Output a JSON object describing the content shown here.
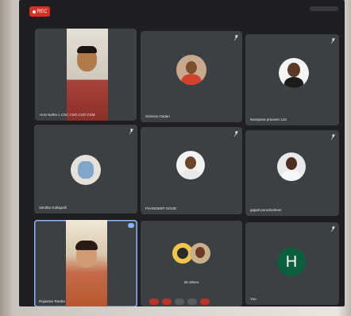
{
  "meeting": {
    "rec_label": "REC",
    "participants": [
      {
        "name": "HoS Nalha 1 CSC CSO CSO CSM",
        "type": "video"
      },
      {
        "name": "Srinivas Gadari",
        "type": "avatar"
      },
      {
        "name": "Narayana praveen 143",
        "type": "avatar"
      },
      {
        "name": "Vanitha Gollapalli",
        "type": "avatar"
      },
      {
        "name": "PSANDEEP GOUD",
        "type": "avatar"
      },
      {
        "name": "gajaal purushotham",
        "type": "avatar"
      },
      {
        "name": "Rajasree Tandra",
        "type": "video"
      },
      {
        "name": "28 others",
        "type": "group"
      },
      {
        "name": "You",
        "type": "letter",
        "letter": "H"
      }
    ]
  },
  "colors": {
    "tile": "#3c4043",
    "background": "#1f1f21",
    "rec": "#d93025",
    "you_avatar": "#0b5e3e",
    "speaking_border": "#8ab4f8"
  }
}
